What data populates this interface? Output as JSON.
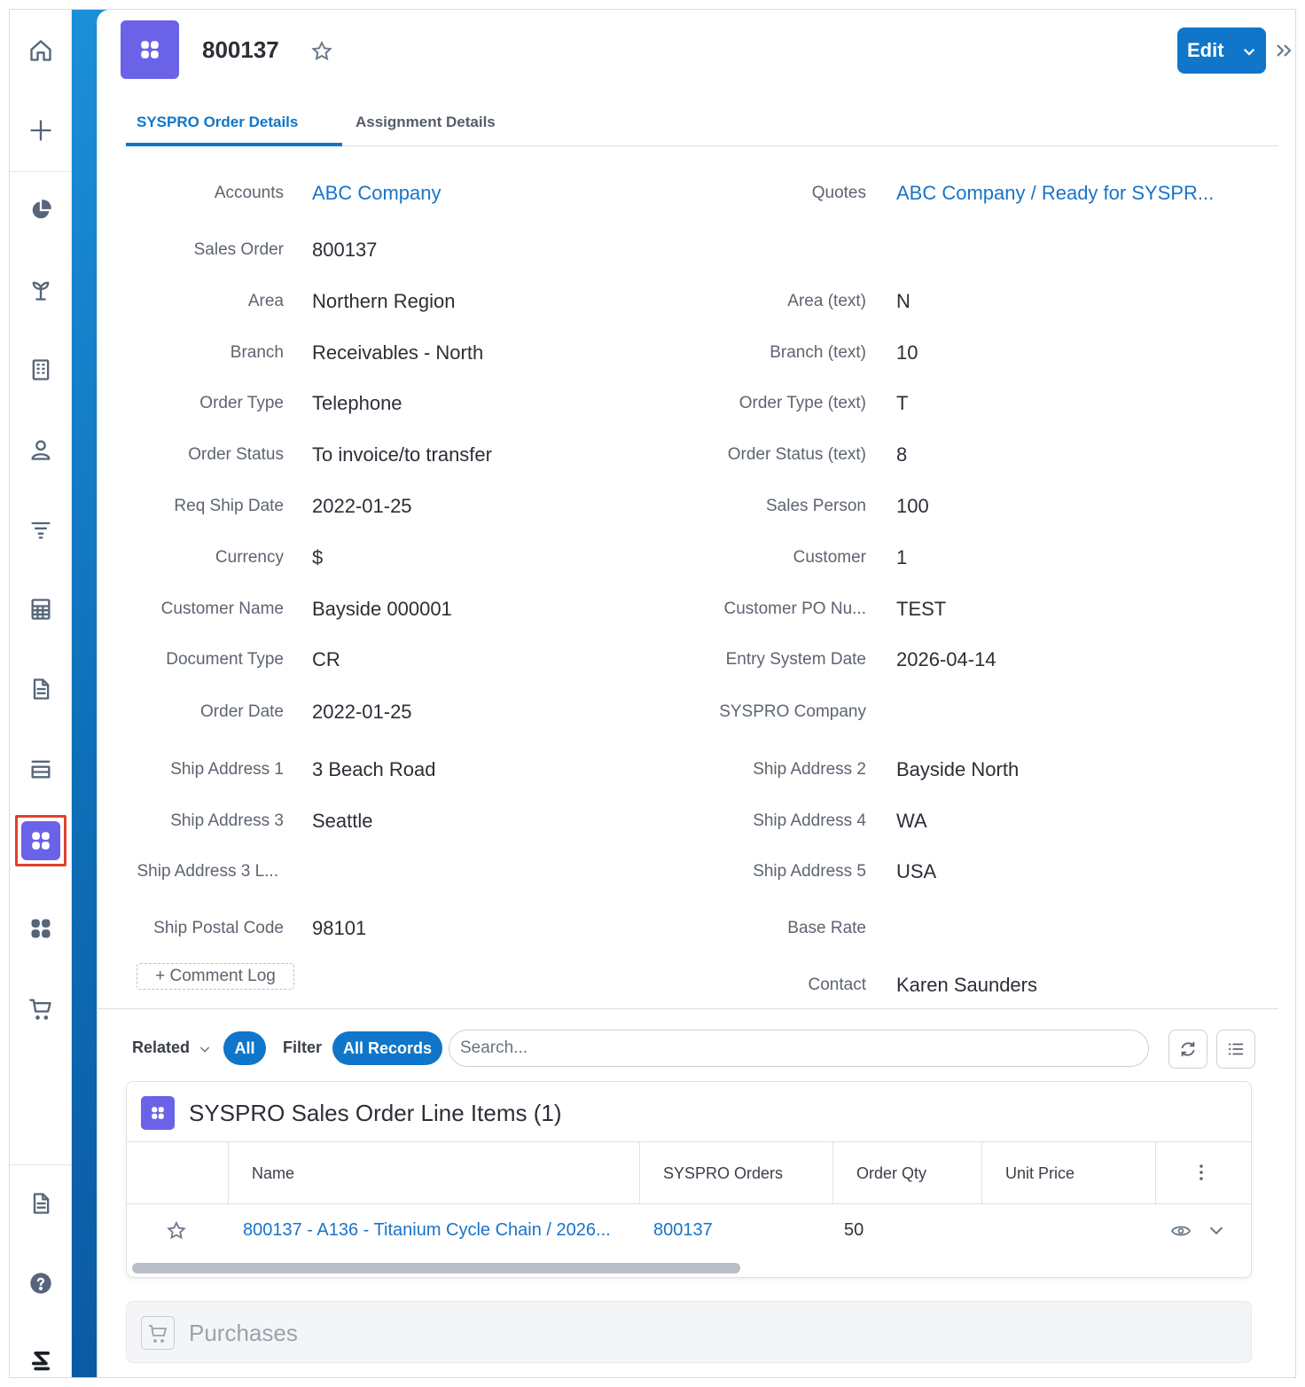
{
  "record": {
    "title": "800137"
  },
  "header": {
    "edit_label": "Edit"
  },
  "tabs": [
    {
      "label": "SYSPRO Order Details",
      "active": true
    },
    {
      "label": "Assignment Details",
      "active": false
    }
  ],
  "fields_left": [
    {
      "label": "Accounts",
      "value": "ABC Company",
      "link": true
    },
    {
      "label": "Sales Order",
      "value": "800137"
    },
    {
      "label": "Area",
      "value": "Northern Region"
    },
    {
      "label": "Branch",
      "value": "Receivables - North"
    },
    {
      "label": "Order Type",
      "value": "Telephone"
    },
    {
      "label": "Order Status",
      "value": "To invoice/to transfer"
    },
    {
      "label": "Req Ship Date",
      "value": "2022-01-25"
    },
    {
      "label": "Currency",
      "value": "$"
    },
    {
      "label": "Customer Name",
      "value": "Bayside 000001"
    },
    {
      "label": "Document Type",
      "value": "CR"
    },
    {
      "label": "Order Date",
      "value": "2022-01-25"
    },
    {
      "label": "Ship Address 1",
      "value": "3 Beach Road"
    },
    {
      "label": "Ship Address 3",
      "value": "Seattle"
    },
    {
      "label": "Ship Address 3 L...",
      "value": ""
    },
    {
      "label": "Ship Postal Code",
      "value": "98101"
    }
  ],
  "fields_right": [
    {
      "label": "Quotes",
      "value": "ABC Company / Ready for SYSPR...",
      "link": true
    },
    {
      "label": "",
      "value": ""
    },
    {
      "label": "Area (text)",
      "value": "N"
    },
    {
      "label": "Branch (text)",
      "value": "10"
    },
    {
      "label": "Order Type (text)",
      "value": "T"
    },
    {
      "label": "Order Status (text)",
      "value": "8"
    },
    {
      "label": "Sales Person",
      "value": "100"
    },
    {
      "label": "Customer",
      "value": "1"
    },
    {
      "label": "Customer PO Nu...",
      "value": "TEST"
    },
    {
      "label": "Entry System Date",
      "value": "2026-04-14"
    },
    {
      "label": "SYSPRO Company",
      "value": ""
    },
    {
      "label": "Ship Address 2",
      "value": "Bayside North"
    },
    {
      "label": "Ship Address 4",
      "value": "WA"
    },
    {
      "label": "Ship Address 5",
      "value": "USA"
    },
    {
      "label": "Base Rate",
      "value": ""
    },
    {
      "label": "Contact",
      "value": "Karen Saunders"
    }
  ],
  "comment_log_label": "+ Comment Log",
  "related_bar": {
    "related_label": "Related",
    "all_pill": "All",
    "filter_label": "Filter",
    "all_records_pill": "All Records",
    "search_placeholder": "Search..."
  },
  "line_items_panel": {
    "title": "SYSPRO Sales Order Line Items (1)",
    "columns": [
      "Name",
      "SYSPRO Orders",
      "Order Qty",
      "Unit Price"
    ],
    "rows": [
      {
        "name": "800137 - A136 - Titanium Cycle Chain / 2026...",
        "syspro_orders": "800137",
        "order_qty": "50",
        "unit_price": ""
      }
    ]
  },
  "purchases_panel": {
    "title": "Purchases"
  },
  "icons": {
    "nav": [
      "home-icon",
      "plus-icon",
      "pie-chart-icon",
      "plant-icon",
      "building-icon",
      "user-icon",
      "filter-icon",
      "calculator-icon",
      "document-icon",
      "list-icon",
      "apps-icon",
      "apps-icon",
      "cart-icon",
      "document-icon",
      "help-icon",
      "brand-logo-icon"
    ],
    "accent": "#0f76c9",
    "record_icon_color": "#6a63e8",
    "highlight": "#e0412f"
  }
}
